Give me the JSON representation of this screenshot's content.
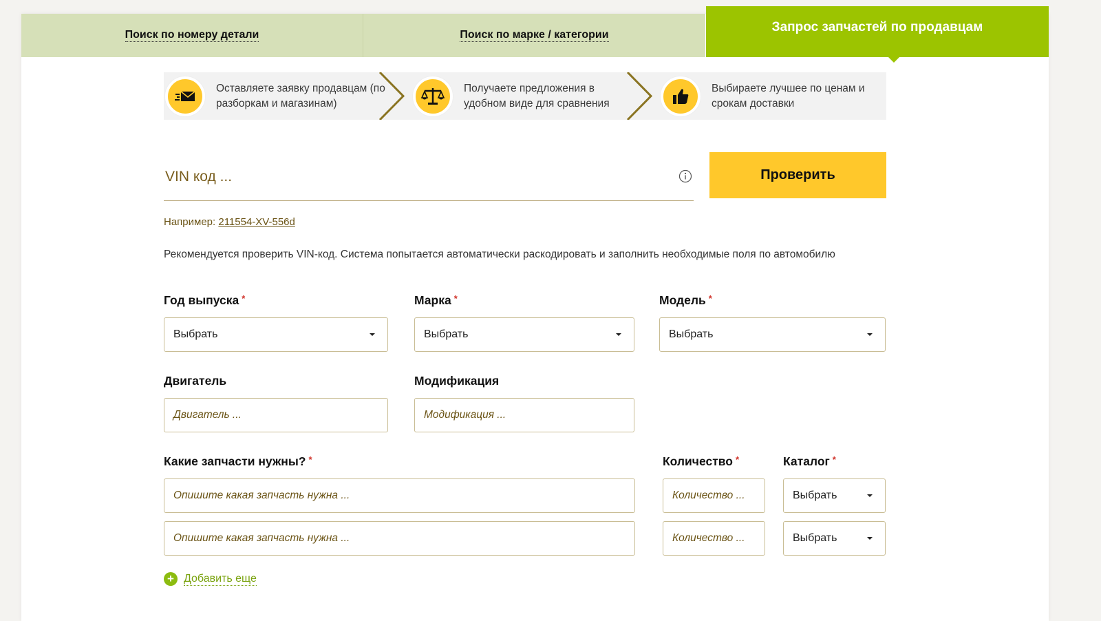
{
  "tabs": {
    "by_part_number": "Поиск по номеру детали",
    "by_brand_category": "Поиск по марке / категории",
    "request_sellers": "Запрос запчастей по продавцам"
  },
  "steps": [
    {
      "icon": "envelope-icon",
      "text": "Оставляете заявку продавцам (по разборкам и магазинам)"
    },
    {
      "icon": "scales-icon",
      "text": "Получаете предложения в удобном виде для сравнения"
    },
    {
      "icon": "thumbs-up-icon",
      "text": "Выбираете лучшее по ценам и срокам доставки"
    }
  ],
  "vin": {
    "placeholder": "VIN код ...",
    "check_button": "Проверить",
    "example_label": "Например:",
    "example_value": "211554-XV-556d",
    "hint": "Рекомендуется проверить VIN-код. Система попытается автоматически раскодировать и заполнить необходимые поля по автомобилю"
  },
  "form": {
    "year_label": "Год выпуска",
    "brand_label": "Марка",
    "model_label": "Модель",
    "engine_label": "Двигатель",
    "modification_label": "Модификация",
    "parts_label": "Какие запчасти нужны?",
    "quantity_label": "Количество",
    "catalog_label": "Каталог",
    "required_mark": "*",
    "select_value": "Выбрать",
    "engine_placeholder": "Двигатель ...",
    "modification_placeholder": "Модификация ...",
    "part_placeholder": "Опишите какая запчасть нужна ...",
    "quantity_placeholder": "Количество ...",
    "add_more": "Добавить еще"
  },
  "colors": {
    "accent_green": "#9cc400",
    "yellow": "#ffc82b",
    "tab_inactive": "#d6e0b8",
    "brown_text": "#6b5416"
  }
}
